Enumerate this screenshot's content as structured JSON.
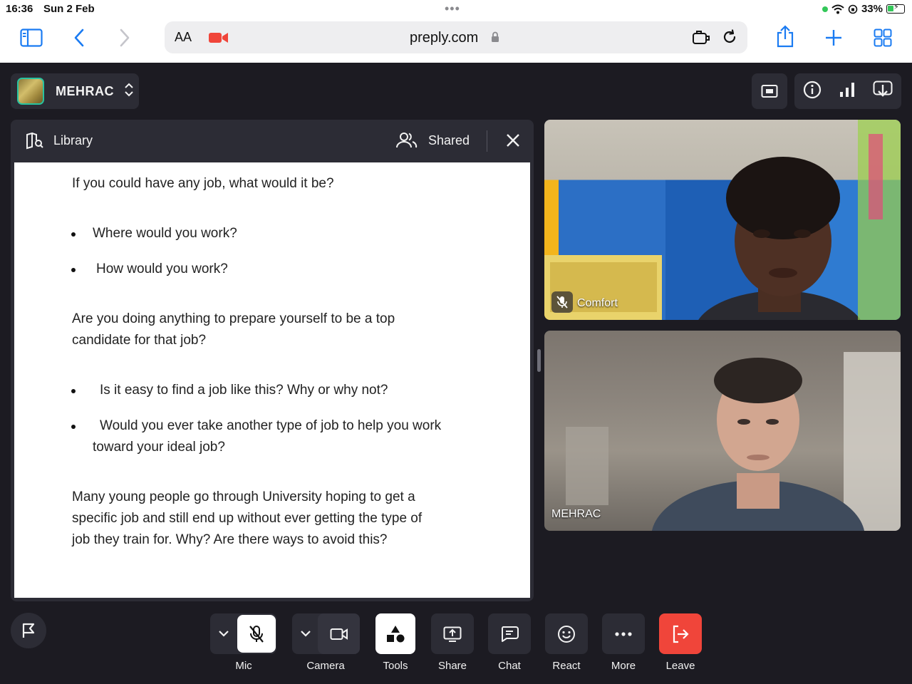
{
  "status_bar": {
    "time": "16:36",
    "date": "Sun 2 Feb",
    "battery": "33%"
  },
  "browser": {
    "text_size": "AA",
    "url": "preply.com",
    "icons": [
      "sidebar-icon",
      "back-icon",
      "forward-icon",
      "camera-recording-icon",
      "lock-icon",
      "extension-icon",
      "reload-icon",
      "share-icon",
      "new-tab-icon",
      "tabs-overview-icon"
    ]
  },
  "header": {
    "user_name": "MEHRAC",
    "accent_color": "#28c3a0"
  },
  "library": {
    "title": "Library",
    "shared_label": "Shared",
    "content": {
      "q1": "If you could have any job, what would it be?",
      "q1_bullets": [
        "Where would you work?",
        "How would you work?"
      ],
      "q2_line1": "Are you doing anything to prepare yourself to be a top",
      "q2_line2": "candidate for that job?",
      "q2_bullet1": "Is it easy to find a job like this? Why or why not?",
      "q2_bullet2_line1": "Would you ever take another type of job to help you work",
      "q2_bullet2_line2": "toward your ideal job?",
      "q3_line1": "Many young people go through University hoping to get a",
      "q3_line2": "specific job and still end up without ever getting the type of",
      "q3_line3": "job they train for. Why? Are there ways to avoid this?"
    }
  },
  "videos": [
    {
      "name": "Comfort",
      "muted": true
    },
    {
      "name": "MEHRAC",
      "muted": false
    }
  ],
  "controls": {
    "mic": "Mic",
    "camera": "Camera",
    "tools": "Tools",
    "share": "Share",
    "chat": "Chat",
    "react": "React",
    "more": "More",
    "leave": "Leave",
    "leave_color": "#f0453a"
  }
}
